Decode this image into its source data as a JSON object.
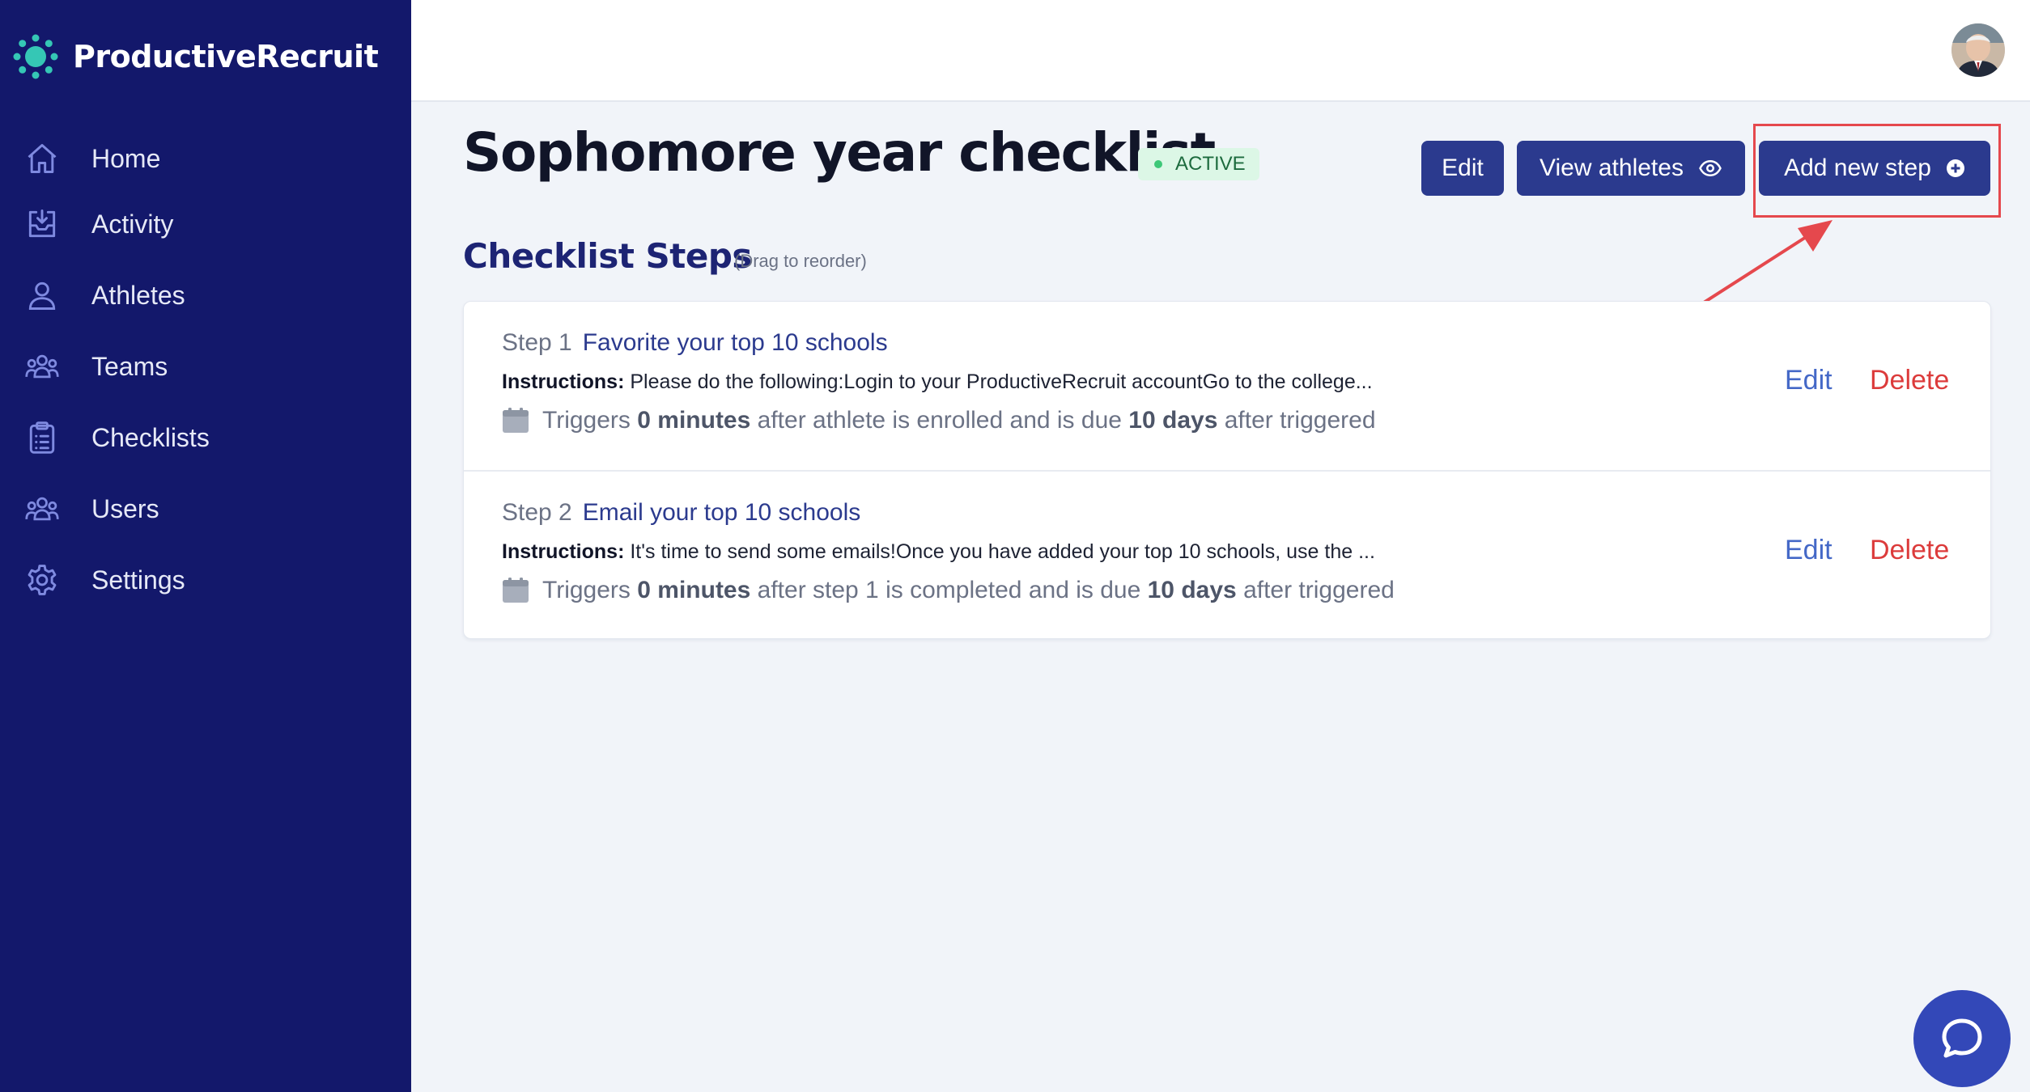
{
  "app": {
    "name": "ProductiveRecruit"
  },
  "sidebar": {
    "items": [
      {
        "label": "Home",
        "icon": "home-icon"
      },
      {
        "label": "Activity",
        "icon": "inbox-download-icon"
      },
      {
        "label": "Athletes",
        "icon": "user-icon"
      },
      {
        "label": "Teams",
        "icon": "user-group-icon"
      },
      {
        "label": "Checklists",
        "icon": "clipboard-list-icon"
      },
      {
        "label": "Users",
        "icon": "user-group-icon"
      },
      {
        "label": "Settings",
        "icon": "gear-icon"
      }
    ]
  },
  "header": {
    "title": "Sophomore year checklist",
    "status": "ACTIVE",
    "buttons": {
      "edit": "Edit",
      "view_athletes": "View athletes",
      "add_step": "Add new step"
    }
  },
  "section": {
    "title": "Checklist Steps",
    "hint": "(Drag to reorder)"
  },
  "steps": [
    {
      "number": "Step 1",
      "name": "Favorite your top 10 schools",
      "instructions_label": "Instructions:",
      "instructions": "Please do the following:Login to your ProductiveRecruit accountGo to the college...",
      "trigger_prefix": "Triggers",
      "trigger_amount": "0 minutes",
      "trigger_middle": "after athlete is enrolled and is due",
      "due_amount": "10 days",
      "trigger_suffix": "after triggered",
      "edit_label": "Edit",
      "delete_label": "Delete"
    },
    {
      "number": "Step 2",
      "name": "Email your top 10 schools",
      "instructions_label": "Instructions:",
      "instructions": "It's time to send some emails!Once you have added your top 10 schools, use the ...",
      "trigger_prefix": "Triggers",
      "trigger_amount": "0 minutes",
      "trigger_middle": "after step 1 is completed and is due",
      "due_amount": "10 days",
      "trigger_suffix": "after triggered",
      "edit_label": "Edit",
      "delete_label": "Delete"
    }
  ],
  "colors": {
    "sidebar_bg": "#13186b",
    "primary_button": "#2b3a8e",
    "active_badge_bg": "#dcf7e6",
    "delete": "#dc3b3b",
    "edit_link": "#4468c7",
    "highlight": "#e5484d"
  }
}
